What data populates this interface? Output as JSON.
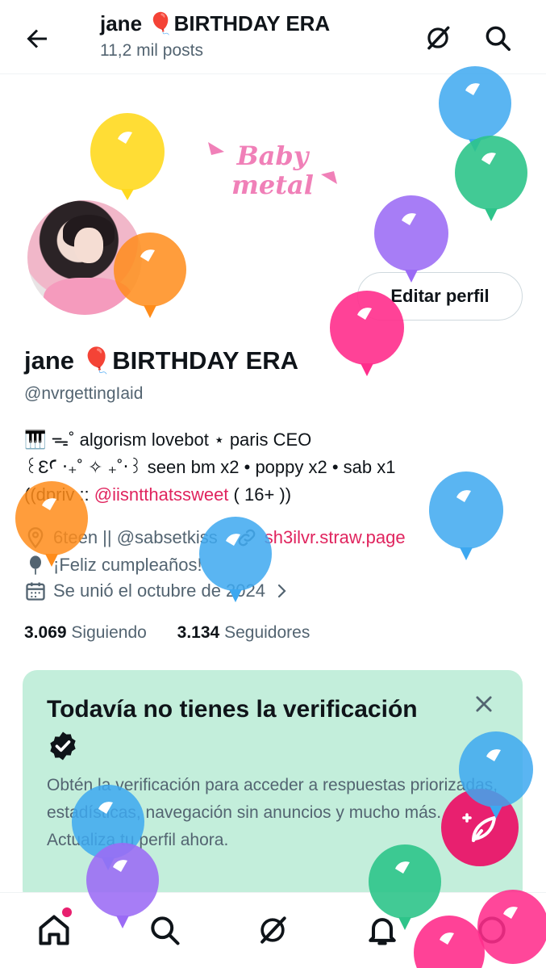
{
  "header": {
    "title": "jane 🎈BIRTHDAY ERA",
    "subtitle": "11,2 mil posts"
  },
  "banner": {
    "logo_alt": "BabyMetal"
  },
  "profile": {
    "edit_button": "Editar perfil",
    "name": "jane 🎈BIRTHDAY ERA",
    "handle": "@nvrgettingIaid",
    "bio_line1": "🎹 ᯓ˚ algorism lovebot ⋆ paris CEO",
    "bio_line2": "꒰ƐꜤ ‧₊˚ ✧ ₊˚‧꒱ seen bm x2 • poppy x2 • sab x1",
    "bio_line3_prefix": "((dpriv :: ",
    "bio_line3_mention": "@iisntthatssweet",
    "bio_line3_suffix": " ( 16+ ))",
    "location": "6teen || @sabsetkiss",
    "website": "sh3ilvr.straw.page",
    "birthday": "¡Feliz cumpleaños!",
    "joined": "Se unió el octubre de 2024",
    "following_count": "3.069",
    "following_label": "Siguiendo",
    "followers_count": "3.134",
    "followers_label": "Seguidores"
  },
  "verification_card": {
    "title": "Todavía no tienes la verificación",
    "body": "Obtén la verificación para acceder a respuestas priorizadas, estadísticas, navegación sin anuncios y mucho más. Actualiza tu perfil ahora."
  },
  "colors": {
    "accent": "#e8206f",
    "card_bg": "#c3eedb",
    "text_secondary": "#536471"
  },
  "icons": {
    "back": "arrow-left-icon",
    "grok": "grok-icon",
    "search": "search-icon",
    "compose": "compose-feather-icon",
    "home": "home-icon",
    "notifications": "bell-icon",
    "messages": "messages-icon"
  }
}
